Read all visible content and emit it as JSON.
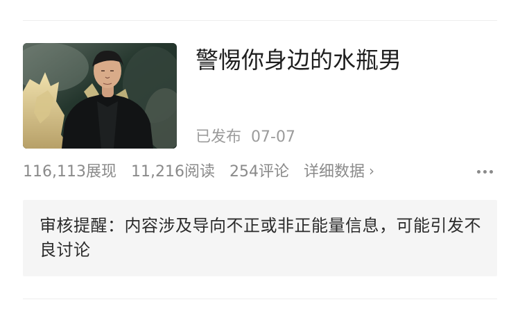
{
  "article": {
    "title": "警惕你身边的水瓶男",
    "status": "已发布",
    "date": "07-07",
    "thumbnail_alt": "man-in-black-coat-photo"
  },
  "stats": {
    "impressions": "116,113展现",
    "reads": "11,216阅读",
    "comments": "254评论",
    "detail_link": "详细数据",
    "detail_icon": "chevron-right-icon",
    "more_icon": "more-horizontal-icon"
  },
  "review": {
    "text": "审核提醒：内容涉及导向不正或非正能量信息，可能引发不良讨论"
  }
}
